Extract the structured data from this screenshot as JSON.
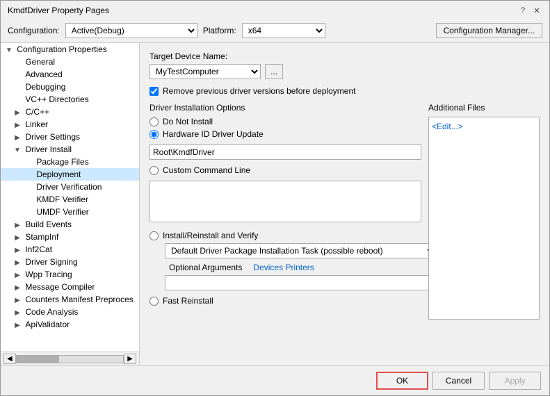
{
  "window": {
    "title": "KmdfDriver Property Pages",
    "help_label": "?",
    "close_label": "✕"
  },
  "config_bar": {
    "config_label": "Configuration:",
    "config_value": "Active(Debug)",
    "platform_label": "Platform:",
    "platform_value": "x64",
    "config_manager_label": "Configuration Manager..."
  },
  "sidebar": {
    "items": [
      {
        "id": "config-properties",
        "label": "Configuration Properties",
        "level": 0,
        "expandable": true,
        "expanded": true
      },
      {
        "id": "general",
        "label": "General",
        "level": 1,
        "expandable": false
      },
      {
        "id": "advanced",
        "label": "Advanced",
        "level": 1,
        "expandable": false
      },
      {
        "id": "debugging",
        "label": "Debugging",
        "level": 1,
        "expandable": false
      },
      {
        "id": "vc-directories",
        "label": "VC++ Directories",
        "level": 1,
        "expandable": false
      },
      {
        "id": "cpp",
        "label": "C/C++",
        "level": 1,
        "expandable": true,
        "expanded": false
      },
      {
        "id": "linker",
        "label": "Linker",
        "level": 1,
        "expandable": true,
        "expanded": false
      },
      {
        "id": "driver-settings",
        "label": "Driver Settings",
        "level": 1,
        "expandable": true,
        "expanded": false
      },
      {
        "id": "driver-install",
        "label": "Driver Install",
        "level": 1,
        "expandable": true,
        "expanded": true
      },
      {
        "id": "package-files",
        "label": "Package Files",
        "level": 2,
        "expandable": false
      },
      {
        "id": "deployment",
        "label": "Deployment",
        "level": 2,
        "expandable": false,
        "selected": true
      },
      {
        "id": "driver-verification",
        "label": "Driver Verification",
        "level": 2,
        "expandable": false
      },
      {
        "id": "kmdf-verifier",
        "label": "KMDF Verifier",
        "level": 2,
        "expandable": false
      },
      {
        "id": "umdf-verifier",
        "label": "UMDF Verifier",
        "level": 2,
        "expandable": false
      },
      {
        "id": "build-events",
        "label": "Build Events",
        "level": 1,
        "expandable": true,
        "expanded": false
      },
      {
        "id": "stampinf",
        "label": "StampInf",
        "level": 1,
        "expandable": true,
        "expanded": false
      },
      {
        "id": "inf2cat",
        "label": "Inf2Cat",
        "level": 1,
        "expandable": true,
        "expanded": false
      },
      {
        "id": "driver-signing",
        "label": "Driver Signing",
        "level": 1,
        "expandable": true,
        "expanded": false
      },
      {
        "id": "wpp-tracing",
        "label": "Wpp Tracing",
        "level": 1,
        "expandable": true,
        "expanded": false
      },
      {
        "id": "message-compiler",
        "label": "Message Compiler",
        "level": 1,
        "expandable": true,
        "expanded": false
      },
      {
        "id": "counters-manifest",
        "label": "Counters Manifest Preproces",
        "level": 1,
        "expandable": true,
        "expanded": false
      },
      {
        "id": "code-analysis",
        "label": "Code Analysis",
        "level": 1,
        "expandable": true,
        "expanded": false
      },
      {
        "id": "apivalidator",
        "label": "ApiValidator",
        "level": 1,
        "expandable": true,
        "expanded": false
      }
    ]
  },
  "right_panel": {
    "target_device_label": "Target Device Name:",
    "target_device_value": "MyTestComputer",
    "browse_label": "...",
    "remove_checkbox_checked": true,
    "remove_label": "Remove previous driver versions before deployment",
    "driver_install_options_label": "Driver Installation Options",
    "radio_do_not_install": "Do Not Install",
    "radio_hardware_id": "Hardware ID Driver Update",
    "radio_hardware_id_checked": true,
    "hardware_id_value": "Root\\KmdfDriver",
    "radio_custom_command": "Custom Command Line",
    "reinstall_label": "Install/Reinstall and Verify",
    "install_task_value": "Default Driver Package Installation Task (possible reboot)",
    "optional_arguments_label": "Optional Arguments",
    "devices_link": "Devices",
    "printers_link": "Printers",
    "fast_reinstall_label": "Fast Reinstall",
    "additional_files_label": "Additional Files",
    "additional_files_edit": "<Edit...>"
  },
  "buttons": {
    "ok_label": "OK",
    "cancel_label": "Cancel",
    "apply_label": "Apply"
  }
}
